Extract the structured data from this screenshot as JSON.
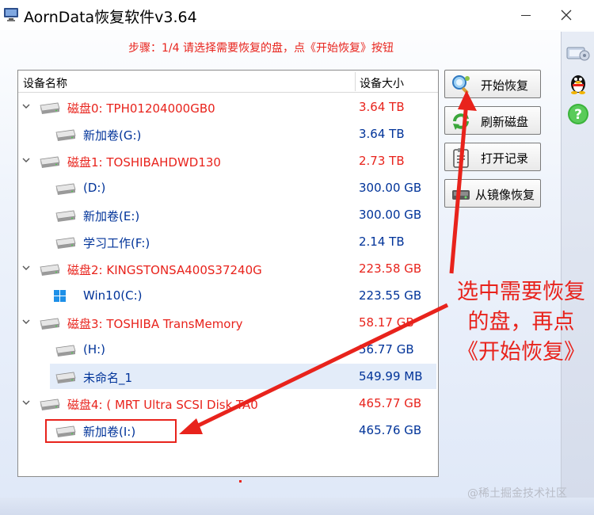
{
  "window": {
    "title": "AornData恢复软件v3.64"
  },
  "step": {
    "text": "步骤：1/4 请选择需要恢复的盘，点《开始恢复》按钮"
  },
  "table": {
    "col_name": "设备名称",
    "col_size": "设备大小",
    "rows": [
      {
        "type": "disk",
        "name": "磁盘0: TPH01204000GB0",
        "size": "3.64 TB"
      },
      {
        "type": "vol",
        "name": "新加卷(G:)",
        "size": "3.64 TB"
      },
      {
        "type": "disk",
        "name": "磁盘1: TOSHIBAHDWD130",
        "size": "2.73 TB"
      },
      {
        "type": "vol",
        "name": "(D:)",
        "size": "300.00 GB"
      },
      {
        "type": "vol",
        "name": "新加卷(E:)",
        "size": "300.00 GB"
      },
      {
        "type": "vol",
        "name": "学习工作(F:)",
        "size": "2.14 TB"
      },
      {
        "type": "disk",
        "name": "磁盘2: KINGSTONSA400S37240G",
        "size": "223.58 GB"
      },
      {
        "type": "vol",
        "name": "Win10(C:)",
        "size": "223.55 GB",
        "icon": "windows-icon"
      },
      {
        "type": "disk",
        "name": "磁盘3: TOSHIBA  TransMemory",
        "size": "58.17 GB"
      },
      {
        "type": "vol",
        "name": "(H:)",
        "size": "56.77 GB"
      },
      {
        "type": "vol",
        "name": "未命名_1",
        "size": "549.99 MB",
        "highlight": true
      },
      {
        "type": "disk",
        "name": "磁盘4: ( MRT Ultra SCSI Disk  TA0",
        "size": "465.77 GB"
      },
      {
        "type": "vol",
        "name": "新加卷(I:)",
        "size": "465.76 GB",
        "selected": true
      }
    ]
  },
  "buttons": {
    "start_recover": "开始恢复",
    "refresh_disk": "刷新磁盘",
    "open_record": "打开记录",
    "from_image": "从镜像恢复"
  },
  "annotation": {
    "line1": "选中需要恢复",
    "line2": "的盘，再点",
    "line3": "《开始恢复》"
  },
  "watermark": "@稀土掘金技术社区",
  "colors": {
    "disk_text": "#e8231c",
    "volume_text": "#003399",
    "annotation": "#e8231c"
  }
}
